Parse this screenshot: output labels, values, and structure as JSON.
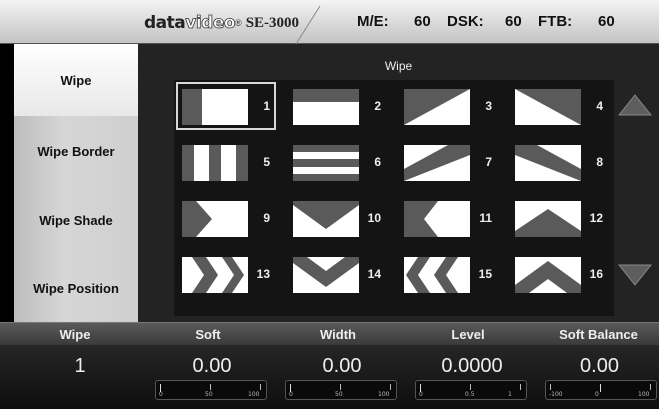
{
  "header": {
    "brand_data": "data",
    "brand_video": "video",
    "brand_mark": "®",
    "model": "SE-3000",
    "me_label": "M/E:",
    "me_value": "60",
    "dsk_label": "DSK:",
    "dsk_value": "60",
    "ftb_label": "FTB:",
    "ftb_value": "60"
  },
  "sidebar": {
    "items": [
      {
        "label": "Wipe",
        "active": true
      },
      {
        "label": "Wipe Border",
        "active": false
      },
      {
        "label": "Wipe Shade",
        "active": false
      },
      {
        "label": "Wipe Position",
        "active": false
      }
    ]
  },
  "panel": {
    "title": "Wipe",
    "selected": 1,
    "patterns": [
      {
        "num": "1",
        "icon": "wipe-vertical-bar-left-icon"
      },
      {
        "num": "2",
        "icon": "wipe-horizontal-bar-top-icon"
      },
      {
        "num": "3",
        "icon": "wipe-diagonal-up-icon"
      },
      {
        "num": "4",
        "icon": "wipe-diagonal-down-icon"
      },
      {
        "num": "5",
        "icon": "wipe-vertical-split-icon"
      },
      {
        "num": "6",
        "icon": "wipe-horizontal-split-icon"
      },
      {
        "num": "7",
        "icon": "wipe-diagonal-band-up-icon"
      },
      {
        "num": "8",
        "icon": "wipe-diagonal-band-down-icon"
      },
      {
        "num": "9",
        "icon": "wipe-arrow-right-icon"
      },
      {
        "num": "10",
        "icon": "wipe-v-down-icon"
      },
      {
        "num": "11",
        "icon": "wipe-arrow-left-icon"
      },
      {
        "num": "12",
        "icon": "wipe-v-up-icon"
      },
      {
        "num": "13",
        "icon": "wipe-double-arrow-right-icon"
      },
      {
        "num": "14",
        "icon": "wipe-double-v-down-icon"
      },
      {
        "num": "15",
        "icon": "wipe-double-arrow-left-icon"
      },
      {
        "num": "16",
        "icon": "wipe-double-v-up-icon"
      }
    ],
    "scroll_up_icon": "triangle-up-icon",
    "scroll_down_icon": "triangle-down-icon"
  },
  "params": [
    {
      "label": "Wipe",
      "value": "1",
      "slider": null
    },
    {
      "label": "Soft",
      "value": "0.00",
      "slider": {
        "ticks": [
          "0",
          "50",
          "100"
        ],
        "level": 0
      }
    },
    {
      "label": "Width",
      "value": "0.00",
      "slider": {
        "ticks": [
          "0",
          "50",
          "100"
        ],
        "level": 0
      }
    },
    {
      "label": "Level",
      "value": "0.0000",
      "slider": {
        "ticks": [
          "0",
          "0.5",
          "1"
        ],
        "level": 0
      }
    },
    {
      "label": "Soft Balance",
      "value": "0.00",
      "slider": {
        "ticks": [
          "-100",
          "0",
          "100"
        ],
        "level": 0.5
      }
    }
  ],
  "colors": {
    "header_bg": "#d6d6d6",
    "panel_bg": "#232323",
    "sidebar_active": "#ffffff",
    "sidebar_inactive": "#c8c8c8",
    "pattern_light": "#ffffff",
    "pattern_dark": "#5a5a5a"
  }
}
